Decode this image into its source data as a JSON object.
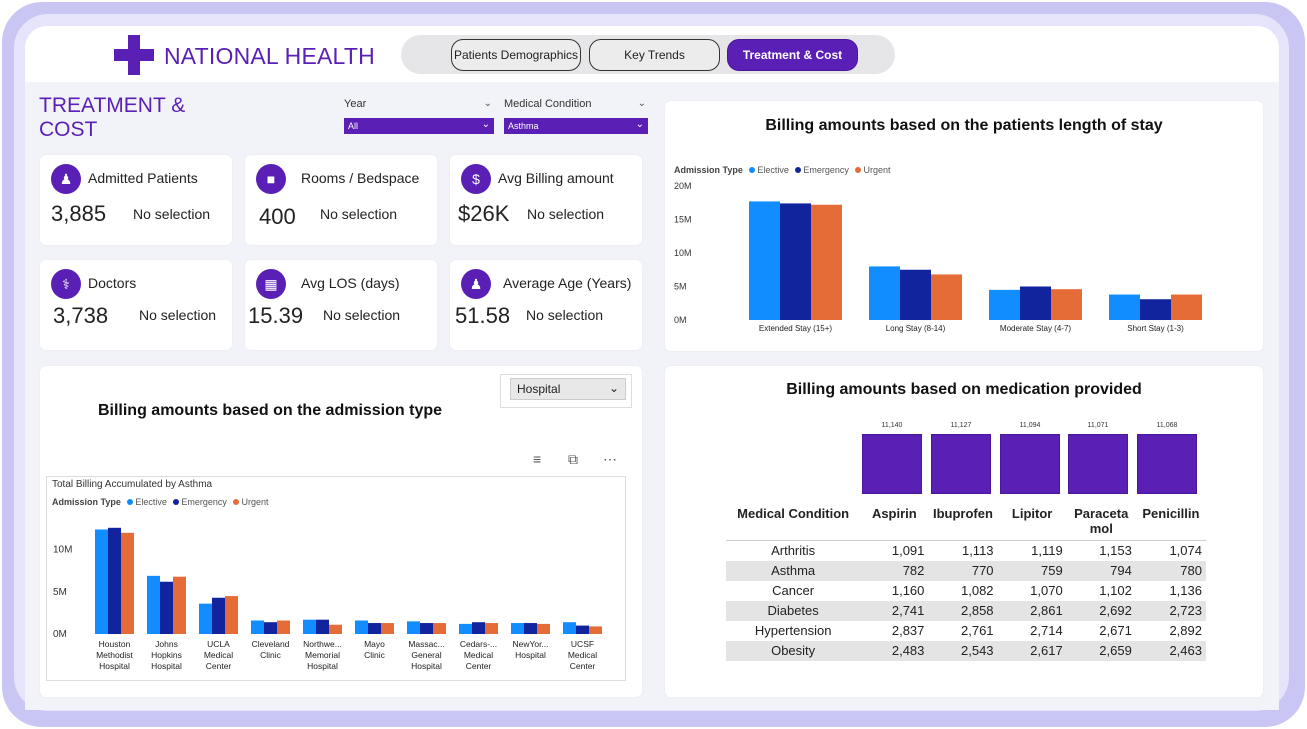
{
  "header": {
    "brand": "NATIONAL HEALTH",
    "tabs": [
      {
        "label": "Patients Demographics",
        "active": false
      },
      {
        "label": "Key Trends",
        "active": false
      },
      {
        "label": "Treatment & Cost",
        "active": true
      }
    ]
  },
  "page_title": "TREATMENT & COST",
  "filters": {
    "year": {
      "label": "Year",
      "value": "All"
    },
    "condition": {
      "label": "Medical Condition",
      "value": "Asthma"
    }
  },
  "kpis": [
    {
      "title": "Admitted Patients",
      "value": "3,885",
      "selection": "No selection",
      "icon": "patient-icon"
    },
    {
      "title": "Rooms / Bedspace",
      "value": "400",
      "selection": "No selection",
      "icon": "bed-icon"
    },
    {
      "title": "Avg Billing amount",
      "value": "$26K",
      "selection": "No selection",
      "icon": "money-bag-icon"
    },
    {
      "title": "Doctors",
      "value": "3,738",
      "selection": "No selection",
      "icon": "doctor-icon"
    },
    {
      "title": "Avg LOS (days)",
      "value": "15.39",
      "selection": "No selection",
      "icon": "calendar-icon"
    },
    {
      "title": "Average Age (Years)",
      "value": "51.58",
      "selection": "No selection",
      "icon": "family-icon"
    }
  ],
  "colors": {
    "elective": "#118dff",
    "emergency": "#12239e",
    "urgent": "#e66c37",
    "accent": "#5a1fb5"
  },
  "admission_chart": {
    "title": "Billing amounts based on the admission type",
    "selector": "Hospital",
    "subtitle": "Total Billing Accumulated by Asthma",
    "legend_title": "Admission Type"
  },
  "medication_chart": {
    "title": "Billing amounts based on medication provided"
  },
  "matrix": {
    "headers": [
      "Medical Condition",
      "Aspirin",
      "Ibuprofen",
      "Lipitor",
      "Paraceta mol",
      "Penicillin"
    ],
    "rows": [
      [
        "Arthritis",
        "1,091",
        "1,113",
        "1,119",
        "1,153",
        "1,074"
      ],
      [
        "Asthma",
        "782",
        "770",
        "759",
        "794",
        "780"
      ],
      [
        "Cancer",
        "1,160",
        "1,082",
        "1,070",
        "1,102",
        "1,136"
      ],
      [
        "Diabetes",
        "2,741",
        "2,858",
        "2,861",
        "2,692",
        "2,723"
      ],
      [
        "Hypertension",
        "2,837",
        "2,761",
        "2,714",
        "2,671",
        "2,892"
      ],
      [
        "Obesity",
        "2,483",
        "2,543",
        "2,617",
        "2,659",
        "2,463"
      ]
    ]
  },
  "chart_data": [
    {
      "type": "bar",
      "title": "Billing amounts based on the patients length of stay",
      "legend_title": "Admission Type",
      "legend": "top-left",
      "categories": [
        "Extended Stay (15+)",
        "Long Stay (8-14)",
        "Moderate Stay (4-7)",
        "Short Stay (1-3)"
      ],
      "series": [
        {
          "name": "Elective",
          "values": [
            17.7,
            8.0,
            4.5,
            3.8
          ]
        },
        {
          "name": "Emergency",
          "values": [
            17.4,
            7.5,
            5.0,
            3.1
          ]
        },
        {
          "name": "Urgent",
          "values": [
            17.2,
            6.8,
            4.6,
            3.8
          ]
        }
      ],
      "ylim": [
        0,
        20
      ],
      "yticks": [
        "0M",
        "5M",
        "10M",
        "15M",
        "20M"
      ]
    },
    {
      "type": "bar",
      "title": "Billing amounts based on the admission type",
      "legend_title": "Admission Type",
      "legend": "top-left",
      "categories": [
        "Houston Methodist Hospital",
        "Johns Hopkins Hospital",
        "UCLA Medical Center",
        "Cleveland Clinic",
        "Northwe... Memorial Hospital",
        "Mayo Clinic",
        "Massac... General Hospital",
        "Cedars-... Medical Center",
        "NewYor... Hospital",
        "UCSF Medical Center"
      ],
      "series": [
        {
          "name": "Elective",
          "values": [
            12.4,
            6.9,
            3.6,
            1.6,
            1.7,
            1.6,
            1.5,
            1.2,
            1.3,
            1.4
          ]
        },
        {
          "name": "Emergency",
          "values": [
            12.6,
            6.2,
            4.3,
            1.4,
            1.7,
            1.3,
            1.3,
            1.4,
            1.3,
            1.0
          ]
        },
        {
          "name": "Urgent",
          "values": [
            12.0,
            6.8,
            4.5,
            1.6,
            1.1,
            1.3,
            1.3,
            1.3,
            1.2,
            0.9
          ]
        }
      ],
      "ylim": [
        0,
        14
      ],
      "yticks": [
        "0M",
        "5M",
        "10M"
      ]
    },
    {
      "type": "bar",
      "title": "Billing amounts based on medication provided",
      "categories": [
        "Aspirin",
        "Ibuprofen",
        "Lipitor",
        "Paraceta mol",
        "Penicillin"
      ],
      "values": [
        11140,
        11127,
        11094,
        11071,
        11068
      ],
      "value_labels": [
        "11,140",
        "11,127",
        "11,094",
        "11,071",
        "11,068"
      ]
    }
  ]
}
